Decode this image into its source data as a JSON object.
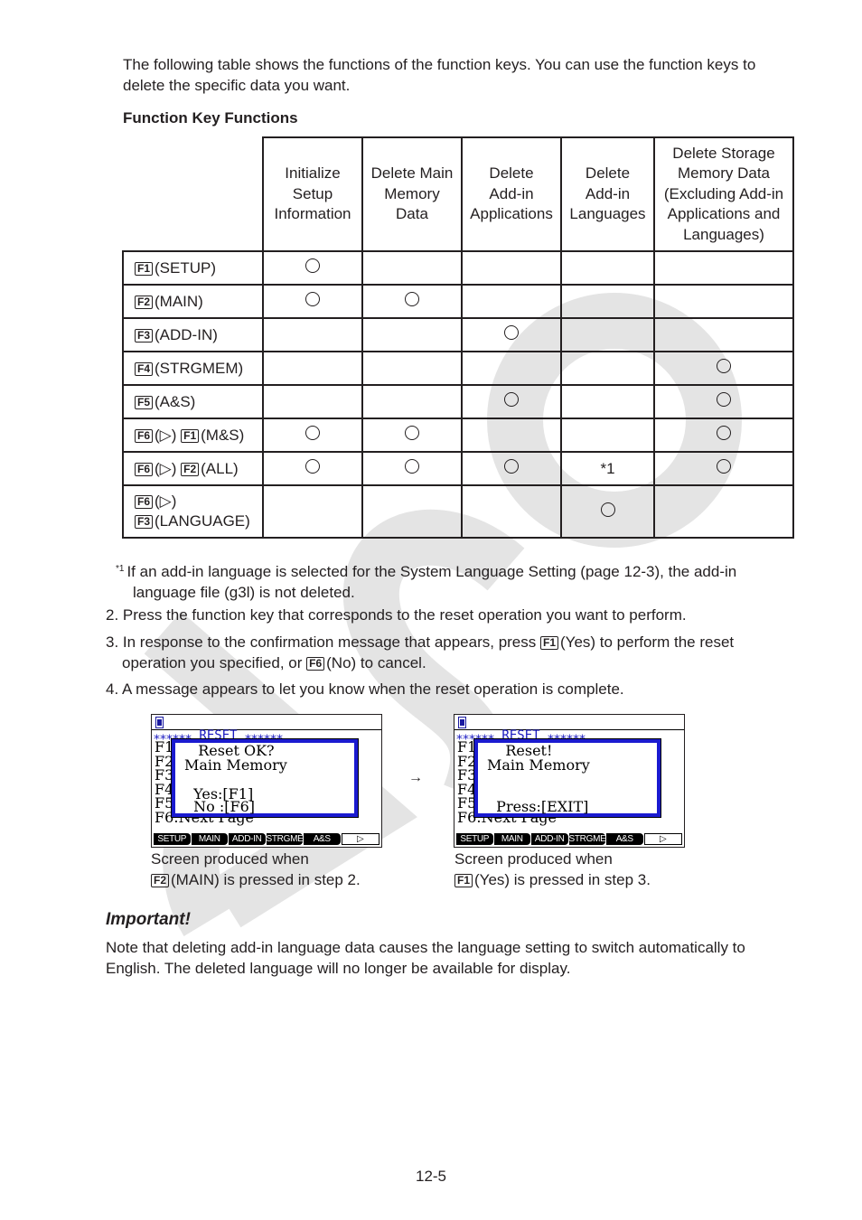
{
  "intro": "The following table shows the functions of the function keys. You can use the function keys to delete the specific data you want.",
  "section_title": "Function Key Functions",
  "table": {
    "columns": [
      "Initialize Setup Information",
      "Delete Main Memory Data",
      "Delete Add-in Applications",
      "Delete Add-in Languages",
      "Delete Storage Memory Data (Excluding Add-in Applications and Languages)"
    ],
    "column_lines": [
      [
        "Initialize",
        "Setup",
        "Information"
      ],
      [
        "Delete Main",
        "Memory",
        "Data"
      ],
      [
        "Delete",
        "Add-in",
        "Applications"
      ],
      [
        "Delete",
        "Add-in",
        "Languages"
      ],
      [
        "Delete Storage",
        "Memory Data",
        "(Excluding Add-in",
        "Applications and",
        "Languages)"
      ]
    ],
    "circle_symbol": "○",
    "arrow_symbol": "(▷)",
    "rows": [
      {
        "keys": [
          "F1"
        ],
        "label": "(SETUP)",
        "cells": [
          "○",
          "",
          "",
          "",
          ""
        ]
      },
      {
        "keys": [
          "F2"
        ],
        "label": "(MAIN)",
        "cells": [
          "○",
          "○",
          "",
          "",
          ""
        ]
      },
      {
        "keys": [
          "F3"
        ],
        "label": "(ADD-IN)",
        "cells": [
          "",
          "",
          "○",
          "",
          ""
        ]
      },
      {
        "keys": [
          "F4"
        ],
        "label": "(STRGMEM)",
        "cells": [
          "",
          "",
          "",
          "",
          "○"
        ]
      },
      {
        "keys": [
          "F5"
        ],
        "label": "(A&S)",
        "cells": [
          "",
          "",
          "○",
          "",
          "○"
        ]
      },
      {
        "keys": [
          "F6",
          "F1"
        ],
        "label": "(M&S)",
        "cells": [
          "○",
          "○",
          "",
          "",
          "○"
        ]
      },
      {
        "keys": [
          "F6",
          "F2"
        ],
        "label": "(ALL)",
        "cells": [
          "○",
          "○",
          "○",
          "*1",
          "○"
        ]
      },
      {
        "keys": [
          "F6",
          "F3"
        ],
        "label": "(LANGUAGE)",
        "cells": [
          "",
          "",
          "",
          "○",
          ""
        ]
      }
    ]
  },
  "footnote": {
    "marker": "*1",
    "line1": "If an add-in language is selected for the System Language Setting (page 12-3), the add-in",
    "line2": "language file (g3l) is not deleted."
  },
  "steps": {
    "s2": "2. Press the function key that corresponds to the reset operation you want to perform.",
    "s3_a": "3. In response to the confirmation message that appears, press",
    "s3_key1": "F1",
    "s3_b": "(Yes) to perform the reset",
    "s3_c": "operation you specified, or",
    "s3_key2": "F6",
    "s3_d": "(No) to cancel.",
    "s4": "4. A message appears to let you know when the reset operation is complete."
  },
  "screens": [
    {
      "title_row": "⁎⁎⁎⁎⁎⁎   RESET   ⁎⁎⁎⁎⁎⁎",
      "bg_lines": [
        "F1",
        "F2",
        "F3",
        "F4",
        "F5",
        "F6:Next Page"
      ],
      "dialog": [
        "   Reset OK?",
        "Main Memory",
        "",
        "  Yes:[F1]",
        "  No :[F6]"
      ],
      "fkeys": [
        "SETUP",
        "MAIN",
        "ADD-IN",
        "STRGMEM",
        "A&S",
        "▷"
      ],
      "caption_line1": "Screen produced when",
      "caption_key": "F2",
      "caption_line2": "(MAIN) is pressed in step 2."
    },
    {
      "title_row": "⁎⁎⁎⁎⁎⁎   RESET   ⁎⁎⁎⁎⁎⁎",
      "bg_lines": [
        "F1",
        "F2",
        "F3",
        "F4",
        "F5",
        "F6:Next Page"
      ],
      "dialog": [
        "    Reset!",
        "Main Memory",
        "",
        "",
        "  Press:[EXIT]"
      ],
      "fkeys": [
        "SETUP",
        "MAIN",
        "ADD-IN",
        "STRGMEM",
        "A&S",
        "▷"
      ],
      "caption_line1": "Screen produced when",
      "caption_key": "F1",
      "caption_line2": "(Yes) is pressed in step 3."
    }
  ],
  "screen_arrow": "→",
  "important": {
    "title": "Important!",
    "body": "Note that deleting add-in language data causes the language setting to switch automatically to English. The deleted language will no longer be available for display."
  },
  "page_number": "12-5",
  "watermark_text": "CASIO",
  "colors": {
    "text": "#231f20",
    "watermark": "#e4e4e4",
    "calc_blue": "#1a1ad0"
  }
}
